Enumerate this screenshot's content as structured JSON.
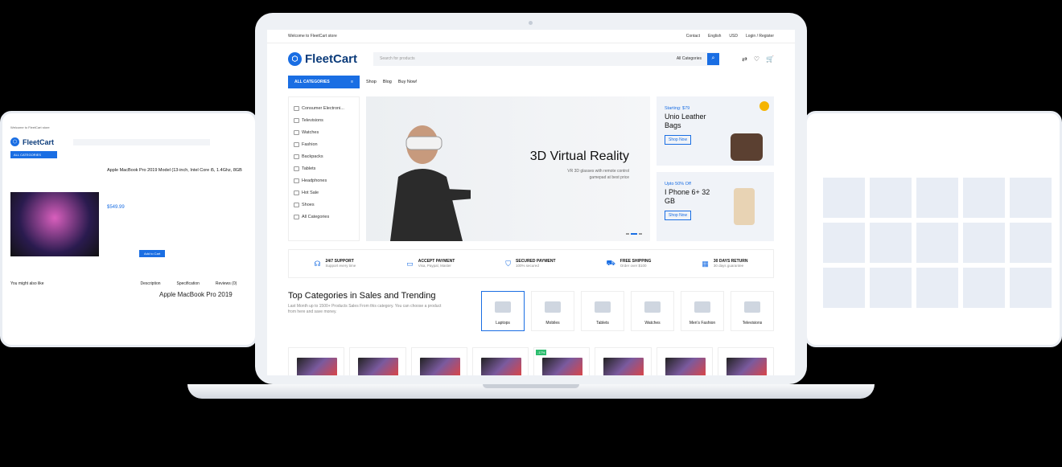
{
  "top": {
    "welcome": "Welcome to FleetCart store",
    "contact": "Contact",
    "language": "English",
    "currency": "USD",
    "login": "Login / Register"
  },
  "brand": {
    "name": "FleetCart",
    "accent": "#1a6ee3"
  },
  "search": {
    "placeholder": "Search for products",
    "category": "All Categories"
  },
  "nav": {
    "all_categories": "ALL CATEGORIES",
    "items": [
      "Shop",
      "Blog",
      "Buy Now!"
    ]
  },
  "categories": [
    "Consumer Electroni...",
    "Televisions",
    "Watches",
    "Fashion",
    "Backpacks",
    "Tablets",
    "Headphones",
    "Hot Sale",
    "Shoes",
    "All Categories"
  ],
  "hero": {
    "title": "3D Virtual Reality",
    "subtitle": "VR 3D glasses with remote control gamepad at best price"
  },
  "promo1": {
    "starting": "Starting: $79",
    "title": "Unio Leather Bags",
    "button": "Shop Now"
  },
  "promo2": {
    "starting": "Upto 50% Off",
    "title": "I Phone 6+ 32 GB",
    "button": "Shop Now"
  },
  "features": [
    {
      "title": "24/7 SUPPORT",
      "sub": "Support every time"
    },
    {
      "title": "ACCEPT PAYMENT",
      "sub": "Visa, Paypal, Master"
    },
    {
      "title": "SECURED PAYMENT",
      "sub": "100% secured"
    },
    {
      "title": "FREE SHIPPING",
      "sub": "Order over $100"
    },
    {
      "title": "30 DAYS RETURN",
      "sub": "30 days guarantee"
    }
  ],
  "top_categories": {
    "title": "Top Categories in Sales and Trending",
    "desc": "Last Month up to 1500+ Products Sales From this category. You can choose a product from here and save money.",
    "tiles": [
      "Laptops",
      "Mobiles",
      "Tablets",
      "Watches",
      "Men's Fashion",
      "Televisions"
    ]
  },
  "left_device": {
    "title": "Apple MacBook Pro 2019 Model (13-inch, Intel Core i5, 1.4Ghz, 8GB",
    "price": "$549.99",
    "add_to_cart": "Add to Cart",
    "tabs": [
      "Description",
      "Specification",
      "Reviews (0)"
    ],
    "heading": "Apple MacBook Pro 2019",
    "you_might": "You might also like"
  },
  "badge": "-17%"
}
